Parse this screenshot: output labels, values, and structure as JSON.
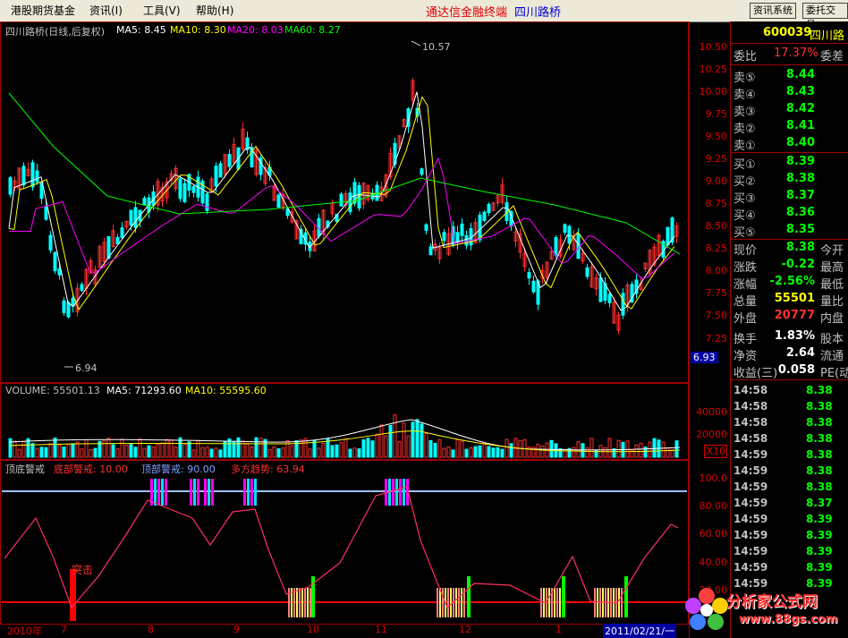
{
  "menu": {
    "items": [
      "港股期货基金",
      "资讯(I)",
      "工具(V)",
      "帮助(H)"
    ],
    "app_title": "通达信金融终端",
    "stock_title": "四川路桥",
    "right_buttons": [
      "资讯系统",
      "委托交易"
    ]
  },
  "main_chart": {
    "header": "四川路桥(日线,后复权)",
    "ma5": "MA5: 8.45",
    "ma10": "MA10: 8.30",
    "ma20": "MA20: 8.03",
    "ma60": "MA60: 8.27",
    "high_label": "10.57",
    "low_label": "6.94",
    "current_price_tag": "6.93",
    "y_ticks": [
      "10.50",
      "10.25",
      "10.00",
      "9.75",
      "9.50",
      "9.25",
      "9.00",
      "8.75",
      "8.50",
      "8.25",
      "8.00",
      "7.75",
      "7.50",
      "7.25"
    ]
  },
  "volume_chart": {
    "header": "VOLUME: 55501.13",
    "ma5": "MA5: 71293.60",
    "ma10": "MA10: 55595.60",
    "y_ticks": [
      "40000",
      "20000"
    ],
    "unit": "X10"
  },
  "indicator": {
    "name": "顶底警戒",
    "bottom_warn": "底部警戒: 10.00",
    "top_warn": "顶部警戒: 90.00",
    "trend": "多方趋势: 63.94",
    "y_ticks": [
      "100.0",
      "80.00",
      "60.00",
      "40.00",
      "20.00"
    ],
    "annotation": "突击"
  },
  "x_axis": {
    "labels": [
      "2010年",
      "7",
      "8",
      "9",
      "10",
      "11",
      "12",
      "1"
    ],
    "cursor_date": "2011/02/21/一"
  },
  "quote": {
    "code": "600039",
    "name": "四川路",
    "weibi_label": "委比",
    "weibi_value": "17.37%",
    "weicha_label": "委差",
    "asks": [
      {
        "label": "卖⑤",
        "price": "8.44"
      },
      {
        "label": "卖④",
        "price": "8.43"
      },
      {
        "label": "卖③",
        "price": "8.42"
      },
      {
        "label": "卖②",
        "price": "8.41"
      },
      {
        "label": "卖①",
        "price": "8.40"
      }
    ],
    "bids": [
      {
        "label": "买①",
        "price": "8.39"
      },
      {
        "label": "买②",
        "price": "8.38"
      },
      {
        "label": "买③",
        "price": "8.37"
      },
      {
        "label": "买④",
        "price": "8.36"
      },
      {
        "label": "买⑤",
        "price": "8.35"
      }
    ],
    "stats": [
      {
        "label": "现价",
        "value": "8.38",
        "right": "今开",
        "color": "#00ff00"
      },
      {
        "label": "涨跌",
        "value": "-0.22",
        "right": "最高",
        "color": "#00ff00"
      },
      {
        "label": "涨幅",
        "value": "-2.56%",
        "right": "最低",
        "color": "#00ff00"
      },
      {
        "label": "总量",
        "value": "55501",
        "right": "量比",
        "color": "#ffff00"
      },
      {
        "label": "外盘",
        "value": "20777",
        "right": "内盘",
        "color": "#ff3030"
      },
      {
        "label": "换手",
        "value": "1.83%",
        "right": "股本",
        "color": "#ffffff"
      },
      {
        "label": "净资",
        "value": "2.64",
        "right": "流通",
        "color": "#ffffff"
      },
      {
        "label": "收益(三)",
        "value": "0.058",
        "right": "PE(动",
        "color": "#ffffff"
      }
    ],
    "ticks": [
      {
        "time": "14:58",
        "price": "8.38"
      },
      {
        "time": "14:58",
        "price": "8.38"
      },
      {
        "time": "14:58",
        "price": "8.38"
      },
      {
        "time": "14:58",
        "price": "8.38"
      },
      {
        "time": "14:59",
        "price": "8.38"
      },
      {
        "time": "14:59",
        "price": "8.38"
      },
      {
        "time": "14:59",
        "price": "8.38"
      },
      {
        "time": "14:59",
        "price": "8.37"
      },
      {
        "time": "14:59",
        "price": "8.39"
      },
      {
        "time": "14:59",
        "price": "8.39"
      },
      {
        "time": "14:59",
        "price": "8.39"
      },
      {
        "time": "14:59",
        "price": "8.39"
      },
      {
        "time": "14:59",
        "price": "8.39"
      }
    ]
  },
  "watermark": {
    "site": "分析家公式网",
    "url": "www.88gs.com"
  },
  "colors": {
    "up": "#ff3030",
    "down": "#00ffff",
    "ma5": "#ffffff",
    "ma10": "#ffff00",
    "ma20": "#ff00ff",
    "ma60": "#00ff00"
  }
}
